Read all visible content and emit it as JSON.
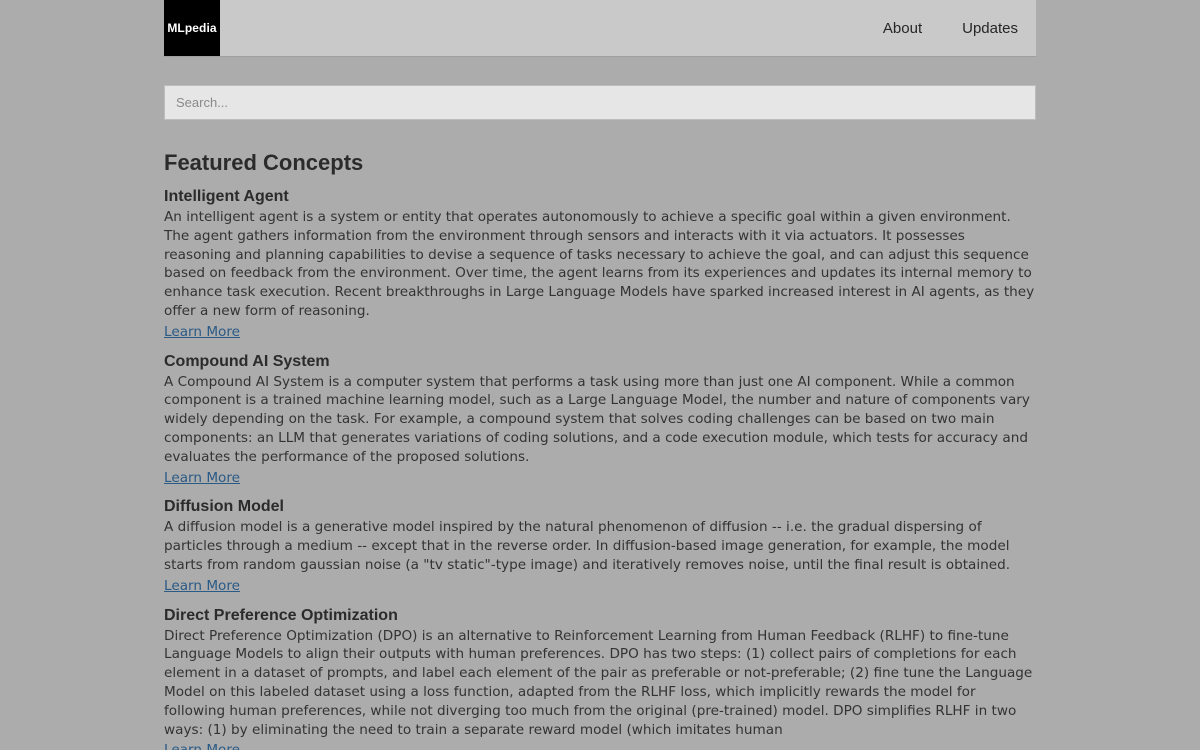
{
  "header": {
    "logo_text": "MLpedia",
    "nav": [
      {
        "label": "About"
      },
      {
        "label": "Updates"
      }
    ]
  },
  "search": {
    "placeholder": "Search...",
    "value": ""
  },
  "main": {
    "section_title": "Featured Concepts",
    "concepts": [
      {
        "title": "Intelligent Agent",
        "description": "An intelligent agent is a system or entity that operates autonomously to achieve a specific goal within a given environment. The agent gathers information from the environment through sensors and interacts with it via actuators. It possesses reasoning and planning capabilities to devise a sequence of tasks necessary to achieve the goal, and can adjust this sequence based on feedback from the environment. Over time, the agent learns from its experiences and updates its internal memory to enhance task execution. Recent breakthroughs in Large Language Models have sparked increased interest in AI agents, as they offer a new form of reasoning.",
        "link_label": "Learn More"
      },
      {
        "title": "Compound AI System",
        "description": "A Compound AI System is a computer system that performs a task using more than just one AI component. While a common component is a trained machine learning model, such as a Large Language Model, the number and nature of components vary widely depending on the task. For example, a compound system that solves coding challenges can be based on two main components: an LLM that generates variations of coding solutions, and a code execution module, which tests for accuracy and evaluates the performance of the proposed solutions.",
        "link_label": "Learn More"
      },
      {
        "title": "Diffusion Model",
        "description": "A diffusion model is a generative model inspired by the natural phenomenon of diffusion -- i.e. the gradual dispersing of particles through a medium -- except that in the reverse order. In diffusion-based image generation, for example, the model starts from random gaussian noise (a \"tv static\"-type image) and iteratively removes noise, until the final result is obtained.",
        "link_label": "Learn More"
      },
      {
        "title": "Direct Preference Optimization",
        "description": "Direct Preference Optimization (DPO) is an alternative to Reinforcement Learning from Human Feedback (RLHF) to fine-tune Language Models to align their outputs with human preferences. DPO has two steps: (1) collect pairs of completions for each element in a dataset of prompts, and label each element of the pair as preferable or not-preferable; (2) fine tune the Language Model on this labeled dataset using a loss function, adapted from the RLHF loss, which implicitly rewards the model for following human preferences, while not diverging too much from the original (pre-trained) model. DPO simplifies RLHF in two ways: (1) by eliminating the need to train a separate reward model (which imitates human",
        "link_label": "Learn More"
      }
    ]
  }
}
